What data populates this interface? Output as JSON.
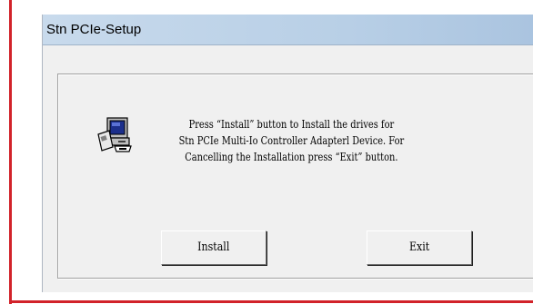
{
  "window": {
    "title": "Stn PCIe-Setup"
  },
  "message": {
    "lines": [
      "Press “Install” button to Install the drives for",
      "Stn PCIe Multi-Io Controller Adapterl Device. For",
      "Cancelling the Installation press “Exit” button."
    ]
  },
  "buttons": {
    "install_label": "Install",
    "exit_label": "Exit"
  },
  "icons": {
    "setup": "computer-setup-icon"
  },
  "colors": {
    "annotation_border": "#d2232a",
    "titlebar": "#b8cfe6",
    "dialog_background": "#f0f0f0"
  }
}
